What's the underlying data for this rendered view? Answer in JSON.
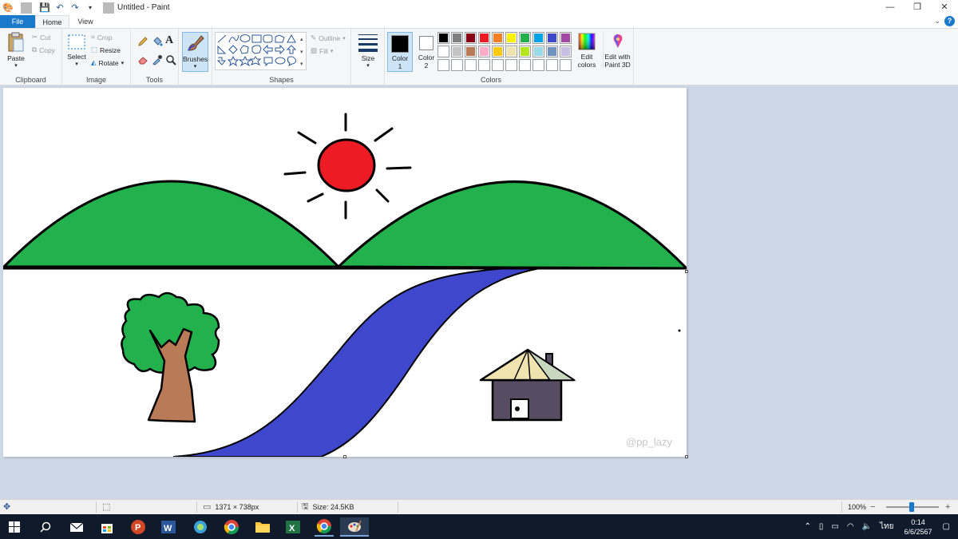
{
  "window": {
    "title": "Untitled - Paint",
    "controls": {
      "minimize": "—",
      "maximize": "❐",
      "close": "✕"
    }
  },
  "tabs": {
    "file": "File",
    "home": "Home",
    "view": "View"
  },
  "ribbon": {
    "clipboard": {
      "label": "Clipboard",
      "paste": "Paste",
      "cut": "Cut",
      "copy": "Copy"
    },
    "image": {
      "label": "Image",
      "select": "Select",
      "crop": "Crop",
      "resize": "Resize",
      "rotate": "Rotate"
    },
    "tools": {
      "label": "Tools"
    },
    "brushes": {
      "label": "Brushes"
    },
    "shapes": {
      "label": "Shapes",
      "outline": "Outline",
      "fill": "Fill"
    },
    "size": {
      "label": "Size"
    },
    "colors": {
      "label": "Colors",
      "color1": "Color",
      "color1_num": "1",
      "color2": "Color",
      "color2_num": "2",
      "edit_colors_line1": "Edit",
      "edit_colors_line2": "colors",
      "paint3d_line1": "Edit with",
      "paint3d_line2": "Paint 3D",
      "color1_value": "#000000",
      "color2_value": "#ffffff",
      "palette_row1": [
        "#000000",
        "#7f7f7f",
        "#880015",
        "#ed1c24",
        "#ff7f27",
        "#fff200",
        "#22b14c",
        "#00a2e8",
        "#3f48cc",
        "#a349a4"
      ],
      "palette_row2": [
        "#ffffff",
        "#c3c3c3",
        "#b97a57",
        "#ffaec9",
        "#ffc90e",
        "#efe4b0",
        "#b5e61d",
        "#99d9ea",
        "#7092be",
        "#c8bfe7"
      ],
      "palette_row3": [
        "#ffffff",
        "#ffffff",
        "#ffffff",
        "#ffffff",
        "#ffffff",
        "#ffffff",
        "#ffffff",
        "#ffffff",
        "#ffffff",
        "#ffffff"
      ]
    }
  },
  "canvas": {
    "watermark": "@pp_lazy",
    "colors": {
      "sky": "#ffffff",
      "hill": "#22b14c",
      "sun": "#ed1c24",
      "river": "#3f48cc",
      "tree_top": "#22b14c",
      "trunk": "#b97a57",
      "roof": "#efe4b0",
      "roof_side": "#c8d8c0",
      "house": "#574c62",
      "outline": "#000000"
    }
  },
  "status": {
    "dimensions": "1371 × 738px",
    "size": "Size: 24.5KB",
    "zoom": "100%",
    "zoom_minus": "−",
    "zoom_plus": "+"
  },
  "taskbar": {
    "lang": "ไทย",
    "time": "0:14",
    "date": "6/6/2567"
  }
}
